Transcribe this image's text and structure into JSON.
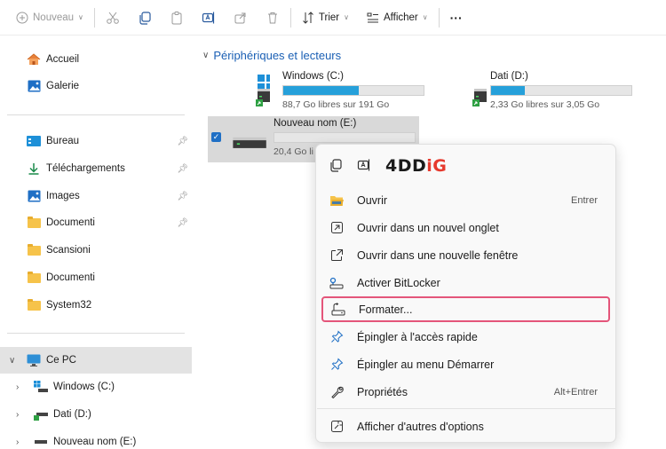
{
  "toolbar": {
    "new_label": "Nouveau",
    "sort_label": "Trier",
    "view_label": "Afficher",
    "more_label": "···"
  },
  "sidebar": {
    "home": "Accueil",
    "gallery": "Galerie",
    "quick": [
      {
        "label": "Bureau",
        "pinned": true
      },
      {
        "label": "Téléchargements",
        "pinned": true
      },
      {
        "label": "Images",
        "pinned": true
      },
      {
        "label": "Documenti",
        "pinned": true
      },
      {
        "label": "Scansioni",
        "pinned": false
      },
      {
        "label": "Documenti",
        "pinned": false
      },
      {
        "label": "System32",
        "pinned": false
      }
    ],
    "this_pc": "Ce PC",
    "drives": [
      "Windows (C:)",
      "Dati (D:)",
      "Nouveau nom (E:)"
    ]
  },
  "main": {
    "section_title": "Périphériques et lecteurs",
    "drives": [
      {
        "name": "Windows (C:)",
        "free": "88,7 Go libres sur 191 Go",
        "used_fraction": 0.54
      },
      {
        "name": "Dati (D:)",
        "free": "2,33 Go libres sur 3,05 Go",
        "used_fraction": 0.24
      },
      {
        "name": "Nouveau nom (E:)",
        "free": "20,4 Go li",
        "used_fraction": 0.0
      }
    ]
  },
  "context_menu": {
    "brand_a": "4DD",
    "brand_b": "iG",
    "items": [
      {
        "label": "Ouvrir",
        "shortcut": "Entrer"
      },
      {
        "label": "Ouvrir dans un nouvel onglet",
        "shortcut": ""
      },
      {
        "label": "Ouvrir dans une nouvelle fenêtre",
        "shortcut": ""
      },
      {
        "label": "Activer BitLocker",
        "shortcut": ""
      },
      {
        "label": "Formater...",
        "shortcut": ""
      },
      {
        "label": "Épingler à l'accès rapide",
        "shortcut": ""
      },
      {
        "label": "Épingler au menu Démarrer",
        "shortcut": ""
      },
      {
        "label": "Propriétés",
        "shortcut": "Alt+Entrer"
      },
      {
        "label": "Afficher d'autres d'options",
        "shortcut": ""
      }
    ]
  },
  "colors": {
    "accent": "#26a0da",
    "link": "#1a5fb4",
    "highlight": "#e4557a",
    "brand_red": "#e63a2e"
  }
}
